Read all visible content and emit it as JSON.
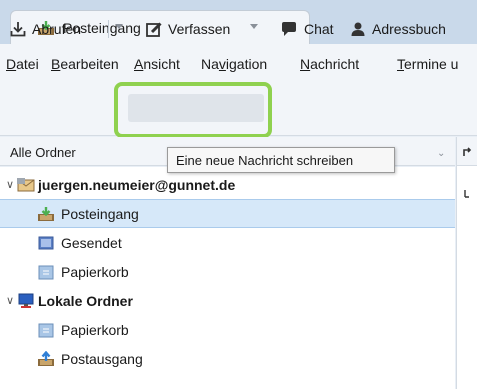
{
  "tab": {
    "title": "Posteingang"
  },
  "menu": {
    "items": [
      {
        "pre": "",
        "key": "D",
        "post": "atei"
      },
      {
        "pre": "",
        "key": "B",
        "post": "earbeiten"
      },
      {
        "pre": "",
        "key": "A",
        "post": "nsicht"
      },
      {
        "pre": "Na",
        "key": "v",
        "post": "igation"
      },
      {
        "pre": "",
        "key": "N",
        "post": "achricht"
      },
      {
        "pre": "",
        "key": "T",
        "post": "ermine u"
      }
    ]
  },
  "toolbar": {
    "get_messages": "Abrufen",
    "write": "Verfassen",
    "chat": "Chat",
    "address_book": "Adressbuch"
  },
  "tooltip": "Eine neue Nachricht schreiben",
  "folder_pane": {
    "header": "Alle Ordner",
    "accounts": [
      {
        "name": "juergen.neumeier@gunnet.de",
        "folders": [
          "Posteingang",
          "Gesendet",
          "Papierkorb"
        ]
      },
      {
        "name": "Lokale Ordner",
        "folders": [
          "Papierkorb",
          "Postausgang"
        ]
      }
    ]
  },
  "colors": {
    "highlight": "#8fd14f",
    "selected_row": "#d6e8f9",
    "inbox_green": "#4caf50"
  }
}
